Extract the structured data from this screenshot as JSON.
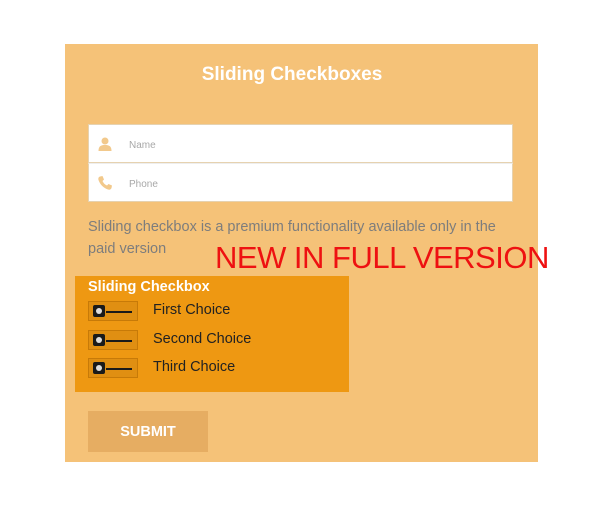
{
  "form": {
    "title": "Sliding Checkboxes",
    "fields": {
      "name": {
        "placeholder": "Name",
        "icon": "user-icon"
      },
      "phone": {
        "placeholder": "Phone",
        "icon": "phone-icon"
      }
    },
    "note": "Sliding checkbox is a premium functionality available only in the paid version",
    "banner": "NEW IN FULL VERSION",
    "sliding_checkbox": {
      "title": "Sliding Checkbox",
      "choices": [
        {
          "label": "First Choice",
          "checked": false
        },
        {
          "label": "Second Choice",
          "checked": false
        },
        {
          "label": "Third Choice",
          "checked": false
        }
      ]
    },
    "submit_label": "SUBMIT"
  },
  "colors": {
    "card_bg": "#f5c278",
    "slide_box_bg": "#ee9812",
    "banner_text": "#ee1111",
    "submit_bg": "#e6ad62"
  }
}
